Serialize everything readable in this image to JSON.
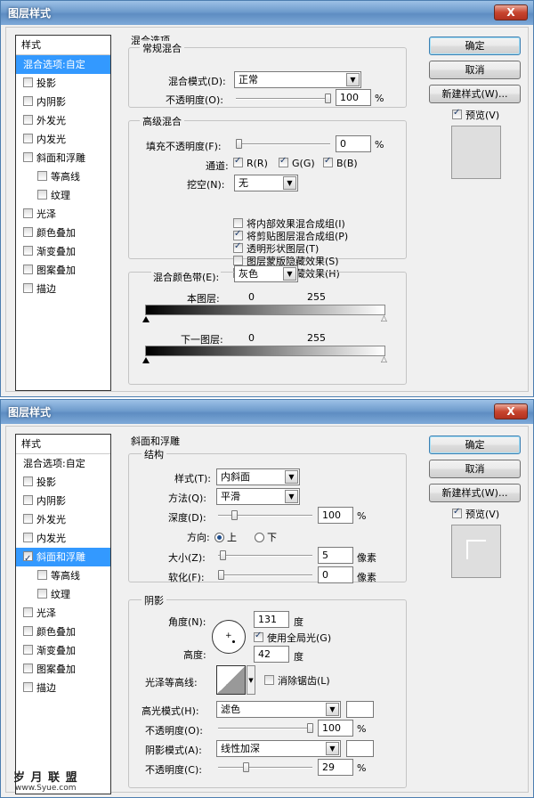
{
  "window1": {
    "title": "图层样式",
    "close": "X",
    "styles_header": "样式",
    "styles": [
      {
        "label": "混合选项:自定",
        "check": false,
        "state": "selected"
      },
      {
        "label": "投影",
        "check": true,
        "checked": false
      },
      {
        "label": "内阴影",
        "check": true,
        "checked": false
      },
      {
        "label": "外发光",
        "check": true,
        "checked": false
      },
      {
        "label": "内发光",
        "check": true,
        "checked": false
      },
      {
        "label": "斜面和浮雕",
        "check": true,
        "checked": false
      },
      {
        "label": "等高线",
        "check": true,
        "checked": false,
        "sub": true
      },
      {
        "label": "纹理",
        "check": true,
        "checked": false,
        "sub": true
      },
      {
        "label": "光泽",
        "check": true,
        "checked": false
      },
      {
        "label": "颜色叠加",
        "check": true,
        "checked": false
      },
      {
        "label": "渐变叠加",
        "check": true,
        "checked": false
      },
      {
        "label": "图案叠加",
        "check": true,
        "checked": false
      },
      {
        "label": "描边",
        "check": true,
        "checked": false
      }
    ],
    "section_title": "混合选项",
    "general": {
      "title": "常规混合",
      "blend_mode_label": "混合模式(D):",
      "blend_mode_value": "正常",
      "opacity_label": "不透明度(O):",
      "opacity_value": "100",
      "pct": "%"
    },
    "advanced": {
      "title": "高级混合",
      "fill_label": "填充不透明度(F):",
      "fill_value": "0",
      "pct": "%",
      "channels_label": "通道:",
      "ch_r": "R(R)",
      "ch_g": "G(G)",
      "ch_b": "B(B)",
      "knockout_label": "挖空(N):",
      "knockout_value": "无",
      "options": [
        {
          "label": "将内部效果混合成组(I)",
          "checked": false
        },
        {
          "label": "将剪贴图层混合成组(P)",
          "checked": true
        },
        {
          "label": "透明形状图层(T)",
          "checked": true
        },
        {
          "label": "图层蒙版隐藏效果(S)",
          "checked": false
        },
        {
          "label": "矢量蒙版隐藏效果(H)",
          "checked": false
        }
      ]
    },
    "blendif": {
      "label": "混合颜色带(E):",
      "value": "灰色",
      "this_layer": "本图层:",
      "under_layer": "下一图层:",
      "min": "0",
      "max": "255"
    },
    "buttons": {
      "ok": "确定",
      "cancel": "取消",
      "new_style": "新建样式(W)...",
      "preview": "预览(V)"
    }
  },
  "window2": {
    "title": "图层样式",
    "close": "X",
    "styles_header": "样式",
    "styles": [
      {
        "label": "混合选项:自定",
        "check": false
      },
      {
        "label": "投影",
        "check": true,
        "checked": false
      },
      {
        "label": "内阴影",
        "check": true,
        "checked": false
      },
      {
        "label": "外发光",
        "check": true,
        "checked": false
      },
      {
        "label": "内发光",
        "check": true,
        "checked": false
      },
      {
        "label": "斜面和浮雕",
        "check": true,
        "checked": true,
        "state": "selected"
      },
      {
        "label": "等高线",
        "check": true,
        "checked": false,
        "sub": true,
        "state": "subselected"
      },
      {
        "label": "纹理",
        "check": true,
        "checked": false,
        "sub": true,
        "state": "subselected"
      },
      {
        "label": "光泽",
        "check": true,
        "checked": false
      },
      {
        "label": "颜色叠加",
        "check": true,
        "checked": false
      },
      {
        "label": "渐变叠加",
        "check": true,
        "checked": false
      },
      {
        "label": "图案叠加",
        "check": true,
        "checked": false
      },
      {
        "label": "描边",
        "check": true,
        "checked": false
      }
    ],
    "section_title": "斜面和浮雕",
    "structure": {
      "title": "结构",
      "style_label": "样式(T):",
      "style_value": "内斜面",
      "method_label": "方法(Q):",
      "method_value": "平滑",
      "depth_label": "深度(D):",
      "depth_value": "100",
      "pct": "%",
      "direction_label": "方向:",
      "dir_up": "上",
      "dir_down": "下",
      "size_label": "大小(Z):",
      "size_value": "5",
      "soften_label": "软化(F):",
      "soften_value": "0",
      "px": "像素"
    },
    "shading": {
      "title": "阴影",
      "angle_label": "角度(N):",
      "angle_value": "131",
      "deg": "度",
      "global_light": "使用全局光(G)",
      "altitude_label": "高度:",
      "altitude_value": "42",
      "gloss_label": "光泽等高线:",
      "antialias": "消除锯齿(L)",
      "highlight_label": "高光模式(H):",
      "highlight_value": "滤色",
      "hl_opacity_label": "不透明度(O):",
      "hl_opacity_value": "100",
      "shadow_label": "阴影模式(A):",
      "shadow_value": "线性加深",
      "sh_opacity_label": "不透明度(C):",
      "sh_opacity_value": "29",
      "pct": "%"
    },
    "buttons": {
      "ok": "确定",
      "cancel": "取消",
      "new_style": "新建样式(W)...",
      "preview": "预览(V)"
    }
  },
  "watermark": {
    "line1": "岁 月 联 盟",
    "line2": "www.Syue.com"
  }
}
